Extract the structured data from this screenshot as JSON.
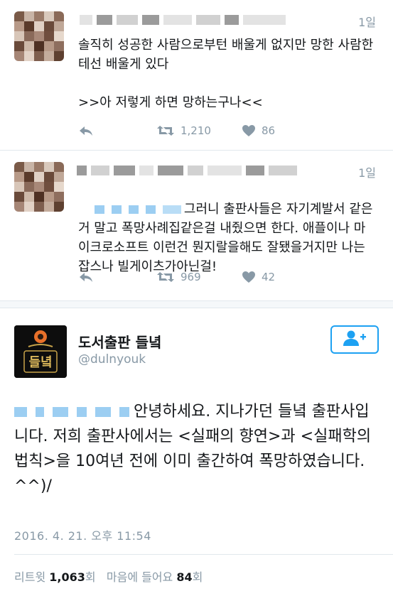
{
  "tweets": [
    {
      "time": "1일",
      "text": "솔직히 성공한 사람으로부턴 배울게 없지만 망한 사람한테선 배울게 있다\n\n>>아 저렇게 하면 망하는구나<<",
      "retweets": "1,210",
      "likes": "86",
      "icons": [
        "reply-icon",
        "retweet-icon",
        "heart-icon"
      ]
    },
    {
      "time": "1일",
      "text": "그러니 출판사들은 자기계발서 같은거 말고 폭망사례집같은걸 내줬으면 한다. 애플이나 마이크로소프트 이런건 뭔지랄을해도 잘됐을거지만 나는 잡스나 빌게이츠가아닌걸!",
      "retweets": "969",
      "likes": "42",
      "icons": [
        "reply-icon",
        "retweet-icon",
        "heart-icon"
      ]
    }
  ],
  "main": {
    "profile_name": "도서출판 들녘",
    "handle": "@dulnyouk",
    "logo_text": "들녘",
    "follow_icon": "follow-user-plus-icon",
    "text": "안녕하세요. 지나가던 들녘 출판사입니다. 저희 출판사에서는 <실패의 향연>과 <실패학의 법칙>을 10여년 전에 이미 출간하여 폭망하였습니다. ^^)/",
    "date": "2016. 4. 21. 오후 11:54",
    "retweet_label": "리트윗",
    "retweet_count": "1,063",
    "retweet_unit": "회",
    "like_label": "마음에 들어요",
    "like_count": "84",
    "like_unit": "회"
  },
  "colors": {
    "accent": "#1da1f2",
    "muted": "#8899a6",
    "text": "#14171a",
    "border": "#e1e8ed"
  }
}
